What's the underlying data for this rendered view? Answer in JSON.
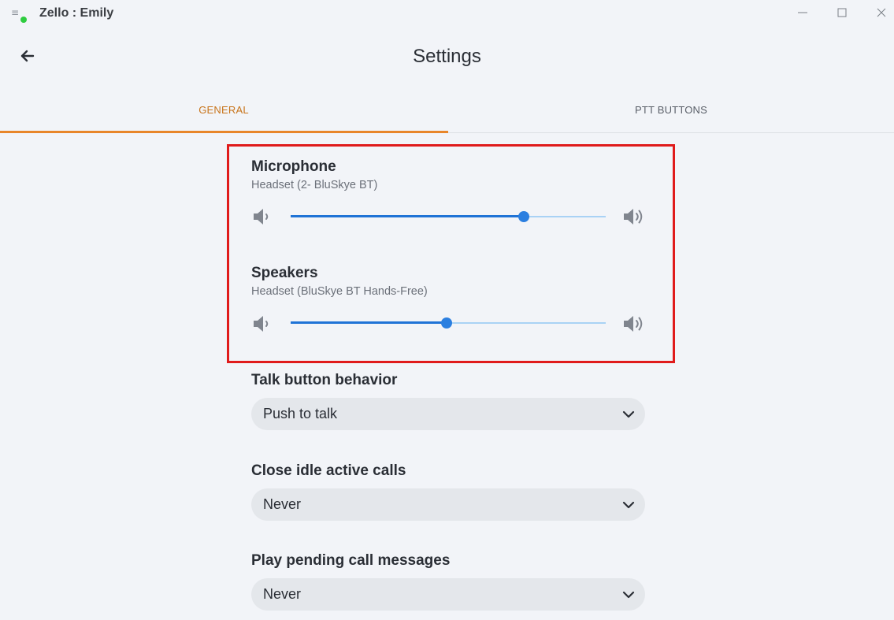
{
  "window": {
    "title": "Zello : Emily",
    "menu_glyph": "≡",
    "status_color": "#2ecc40"
  },
  "header": {
    "title": "Settings"
  },
  "tabs": [
    {
      "label": "GENERAL",
      "active": true
    },
    {
      "label": "PTT BUTTONS",
      "active": false
    }
  ],
  "audio": {
    "microphone": {
      "label": "Microphone",
      "device": "Headset (2- BluSkye BT)",
      "level": 0.74
    },
    "speakers": {
      "label": "Speakers",
      "device": "Headset (BluSkye BT Hands-Free)",
      "level": 0.495
    }
  },
  "settings": {
    "talk_button": {
      "label": "Talk button behavior",
      "value": "Push to talk"
    },
    "close_idle": {
      "label": "Close idle active calls",
      "value": "Never"
    },
    "play_pending": {
      "label": "Play pending call messages",
      "value": "Never"
    }
  },
  "colors": {
    "accent": "#e8862a",
    "slider_fill": "#1f73d6",
    "slider_track": "#a9d2f5",
    "highlight": "#e01b1b"
  },
  "icons": [
    "menu-icon",
    "minimize-icon",
    "maximize-icon",
    "close-icon",
    "back-arrow-icon",
    "volume-low-icon",
    "volume-high-icon",
    "chevron-down-icon"
  ]
}
